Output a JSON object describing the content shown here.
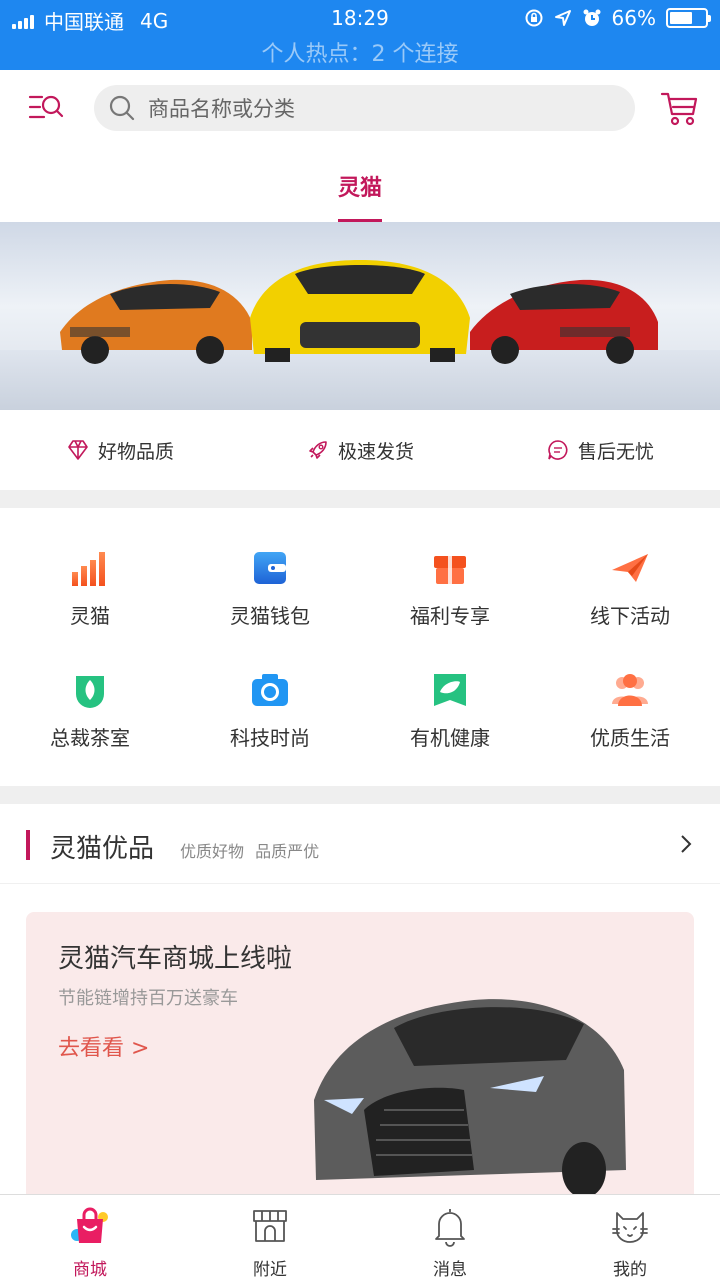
{
  "status_bar": {
    "carrier": "中国联通",
    "network": "4G",
    "time": "18:29",
    "battery": "66%",
    "battery_level": 0.66,
    "hotspot": "个人热点：2 个连接"
  },
  "header": {
    "search_placeholder": "商品名称或分类"
  },
  "tabs": [
    {
      "label": "灵猫",
      "active": true
    }
  ],
  "features": [
    {
      "label": "好物品质",
      "icon": "diamond-icon"
    },
    {
      "label": "极速发货",
      "icon": "rocket-icon"
    },
    {
      "label": "售后无忧",
      "icon": "chat-icon"
    }
  ],
  "categories": [
    {
      "label": "灵猫",
      "icon": "bar-chart-icon"
    },
    {
      "label": "灵猫钱包",
      "icon": "wallet-icon"
    },
    {
      "label": "福利专享",
      "icon": "gift-icon"
    },
    {
      "label": "线下活动",
      "icon": "paper-plane-icon"
    },
    {
      "label": "总裁茶室",
      "icon": "tea-cup-icon"
    },
    {
      "label": "科技时尚",
      "icon": "camera-icon"
    },
    {
      "label": "有机健康",
      "icon": "leaf-icon"
    },
    {
      "label": "优质生活",
      "icon": "people-icon"
    }
  ],
  "section": {
    "title": "灵猫优品",
    "subtitle": "优质好物  品质严优"
  },
  "promo": {
    "title": "灵猫汽车商城上线啦",
    "subtitle": "节能链增持百万送豪车",
    "link": "去看看 >"
  },
  "bottom_nav": [
    {
      "label": "商城",
      "icon": "shopping-bag-icon",
      "active": true
    },
    {
      "label": "附近",
      "icon": "storefront-icon",
      "active": false
    },
    {
      "label": "消息",
      "icon": "bell-icon",
      "active": false
    },
    {
      "label": "我的",
      "icon": "cat-icon",
      "active": false
    }
  ],
  "colors": {
    "status_bar": "#1e87f0",
    "accent": "#c2185b",
    "promo_bg": "#faeaea",
    "promo_link": "#e0564c"
  }
}
